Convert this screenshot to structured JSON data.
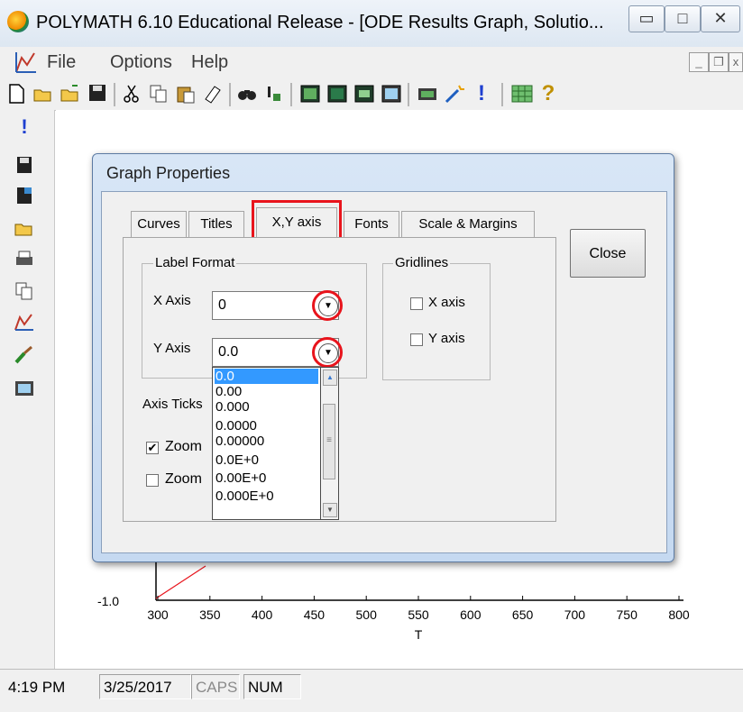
{
  "window": {
    "title": "POLYMATH 6.10 Educational Release - [ODE Results Graph, Solutio...",
    "minimize": "▭",
    "maximize": "□",
    "close": "✕"
  },
  "menu": {
    "items": [
      "File",
      "Options",
      "Help"
    ],
    "mdi_minimize": "_",
    "mdi_restore": "❐",
    "mdi_close": "x"
  },
  "toolbar": {
    "icons": [
      "new-document-icon",
      "open-folder-icon",
      "open-folder-alt-icon",
      "save-icon",
      "cut-icon",
      "copy-icon",
      "paste-icon",
      "eraser-icon",
      "find-icon",
      "replace-icon",
      "graph-window-icon",
      "function-window-icon",
      "calculator-window-icon",
      "table-window-icon",
      "keyboard-icon",
      "wand-icon",
      "exclamation-icon",
      "grid-icon",
      "help-icon"
    ],
    "exclamation_glyph": "!",
    "help_glyph": "?"
  },
  "left_toolbar": {
    "icons": [
      "solve-icon",
      "save-icon",
      "export-icon",
      "open-icon",
      "print-icon",
      "copy-icon",
      "graph-icon",
      "brush-icon",
      "table-icon"
    ],
    "solve_glyph": "!"
  },
  "graph": {
    "y_tick_label": "-1.0",
    "x_ticks": [
      "300",
      "350",
      "400",
      "450",
      "500",
      "550",
      "600",
      "650",
      "700",
      "750",
      "800"
    ],
    "x_axis_label": "T",
    "line_color": "#e8141c"
  },
  "dialog": {
    "title": "Graph Properties",
    "tabs": [
      "Curves",
      "Titles",
      "X,Y axis",
      "Fonts",
      "Scale & Margins"
    ],
    "active_tab": "X,Y axis",
    "close_button": "Close",
    "label_format": {
      "group_label": "Label Format",
      "x_axis_label": "X Axis",
      "x_axis_value": "0",
      "y_axis_label": "Y Axis",
      "y_axis_value": "0.0"
    },
    "gridlines": {
      "group_label": "Gridlines",
      "x_axis_label": "X axis",
      "x_axis_checked": false,
      "y_axis_label": "Y axis",
      "y_axis_checked": false
    },
    "axis_ticks": {
      "label": "Axis Ticks",
      "zoom1_label": "Zoom",
      "zoom1_checked": true,
      "zoom2_label": "Zoom",
      "zoom2_checked": false
    },
    "dropdown_options": [
      "0.0",
      "0.00",
      "0.000",
      "0.0000",
      "0.00000",
      "0.0E+0",
      "0.00E+0",
      "0.000E+0"
    ],
    "dropdown_selected": "0.0",
    "highlight_color": "#e8141c"
  },
  "status": {
    "time": "4:19 PM",
    "date": "3/25/2017",
    "caps": "CAPS",
    "num": "NUM"
  }
}
